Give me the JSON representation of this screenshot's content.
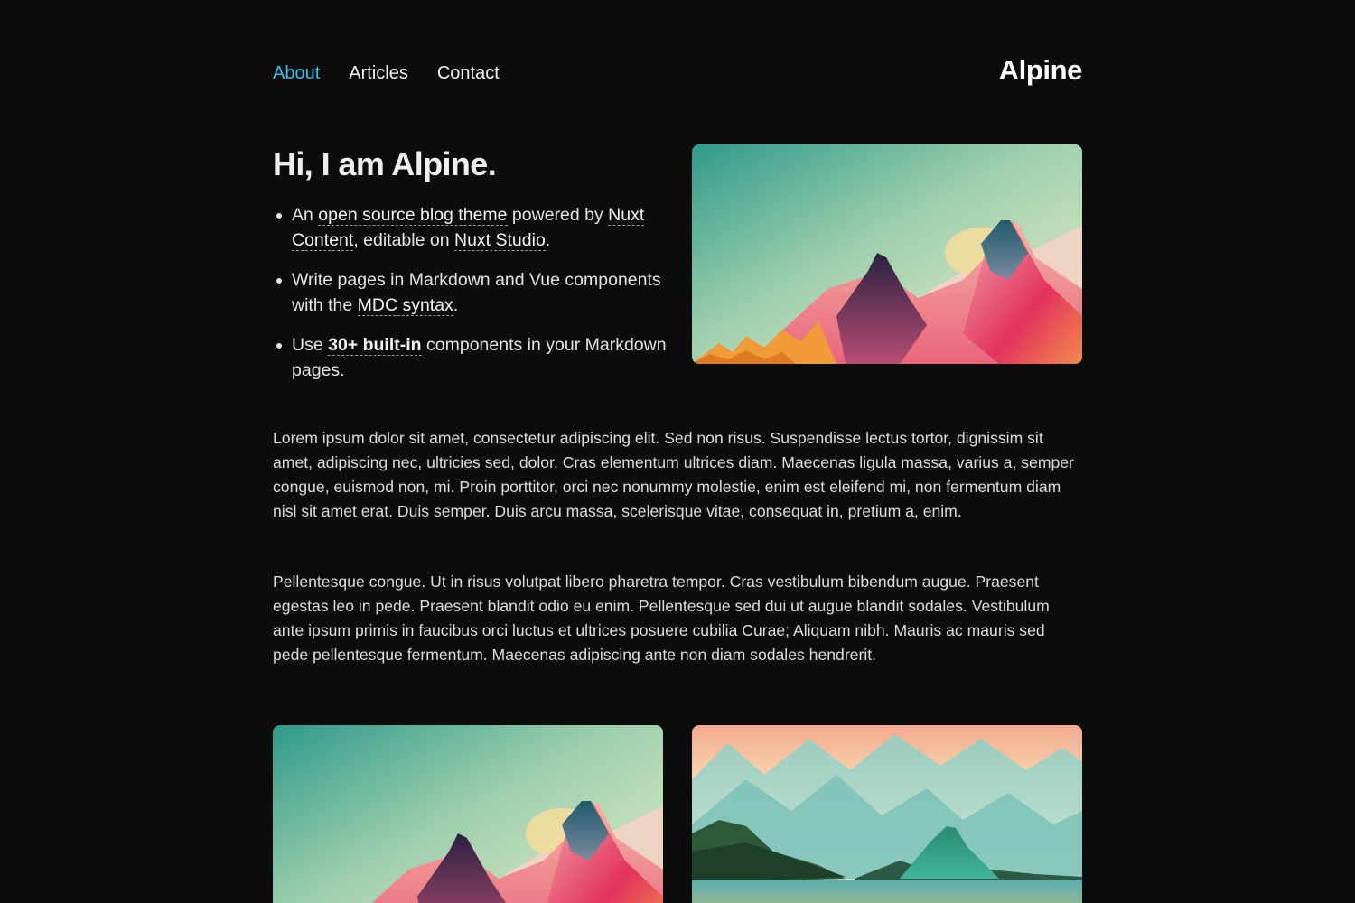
{
  "header": {
    "nav": [
      {
        "label": "About",
        "active": true
      },
      {
        "label": "Articles",
        "active": false
      },
      {
        "label": "Contact",
        "active": false
      }
    ],
    "logo": "Alpine"
  },
  "hero": {
    "title": "Hi, I am Alpine.",
    "items": [
      {
        "t1": "An ",
        "link1": "open source blog theme",
        "t2": " powered by ",
        "link2": "Nuxt Content",
        "t3": ", editable on ",
        "link3": "Nuxt Studio",
        "t4": "."
      },
      {
        "t1": "Write pages in Markdown and Vue components with the ",
        "link1": "MDC syntax",
        "t2": "."
      },
      {
        "t1": "Use ",
        "link1": "30+ built-in",
        "t2": " components in your Markdown pages."
      }
    ],
    "image": "pastel-mountains-illustration"
  },
  "content": {
    "paragraph1": "Lorem ipsum dolor sit amet, consectetur adipiscing elit. Sed non risus. Suspendisse lectus tortor, dignissim sit amet, adipiscing nec, ultricies sed, dolor. Cras elementum ultrices diam. Maecenas ligula massa, varius a, semper congue, euismod non, mi. Proin porttitor, orci nec nonummy molestie, enim est eleifend mi, non fermentum diam nisl sit amet erat. Duis semper. Duis arcu massa, scelerisque vitae, consequat in, pretium a, enim.",
    "paragraph2": "Pellentesque congue. Ut in risus volutpat libero pharetra tempor. Cras vestibulum bibendum augue. Praesent egestas leo in pede. Praesent blandit odio eu enim. Pellentesque sed dui ut augue blandit sodales. Vestibulum ante ipsum primis in faucibus orci luctus et ultrices posuere cubilia Curae; Aliquam nibh. Mauris ac mauris sed pede pellentesque fermentum. Maecenas adipiscing ante non diam sodales hendrerit."
  },
  "gallery": {
    "images": [
      "pastel-mountains-illustration",
      "teal-mountain-lake-illustration"
    ]
  },
  "colors": {
    "background": "#0c0c0c",
    "accent": "#2bc6f0",
    "text": "#e6e6e6"
  }
}
